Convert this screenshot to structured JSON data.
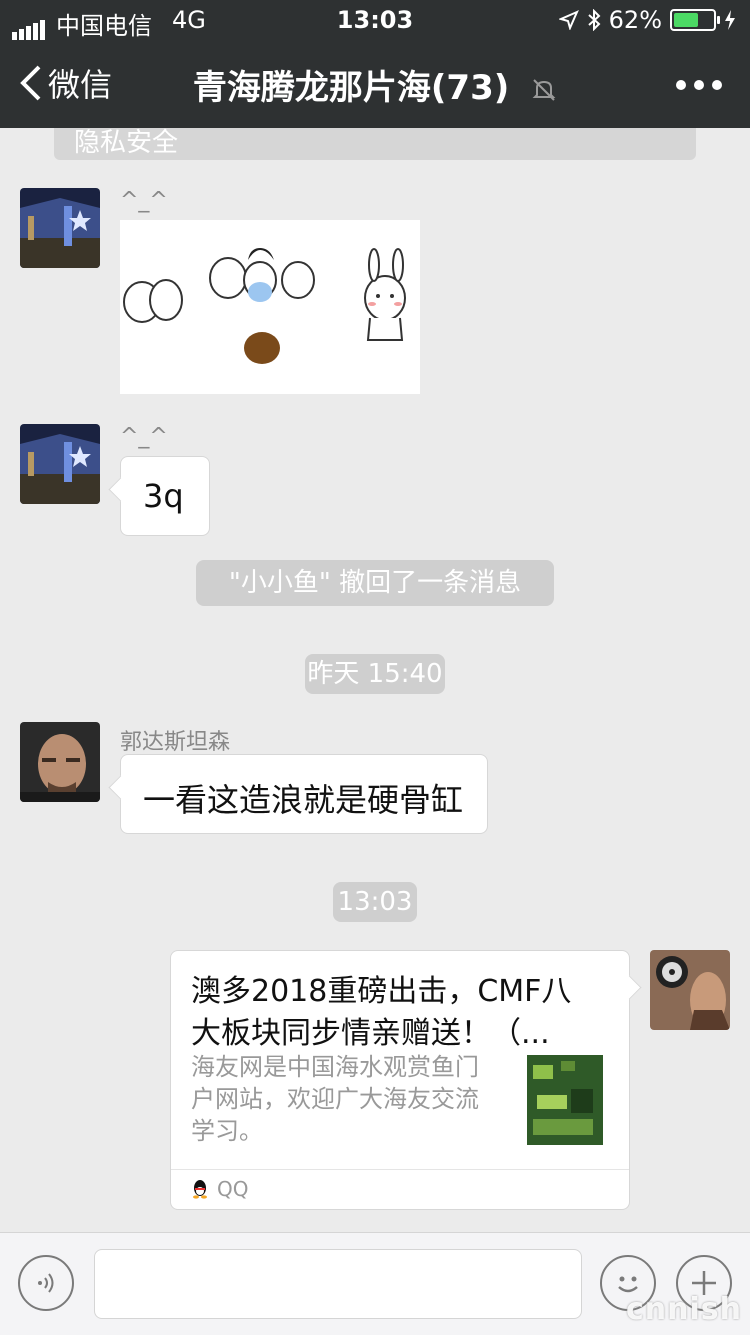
{
  "status_bar": {
    "carrier": "中国电信",
    "network": "4G",
    "time": "13:03",
    "battery": "62%",
    "battery_level": 0.62
  },
  "nav": {
    "back_label": "微信",
    "title": "青海腾龙那片海(73)"
  },
  "messages": {
    "top_system": "隐私安全",
    "msg1_nick": "^_^",
    "msg2_nick": "^_^",
    "msg2_text": "3q",
    "recall_notice": "\"小小鱼\" 撤回了一条消息",
    "time_yesterday": "昨天 15:40",
    "msg3_nick": "郭达斯坦森",
    "msg3_text": "一看这造浪就是硬骨缸",
    "time_today": "13:03"
  },
  "link_card": {
    "title": "澳多2018重磅出击，CMF八大板块同步情亲赠送！（...",
    "description": "海友网是中国海水观赏鱼门户网站，欢迎广大海友交流学习。",
    "source": "QQ"
  },
  "watermark": "cnnish",
  "colors": {
    "header": "#2e3132",
    "chat_bg": "#ebebeb",
    "battery_fill": "#4cd964"
  }
}
